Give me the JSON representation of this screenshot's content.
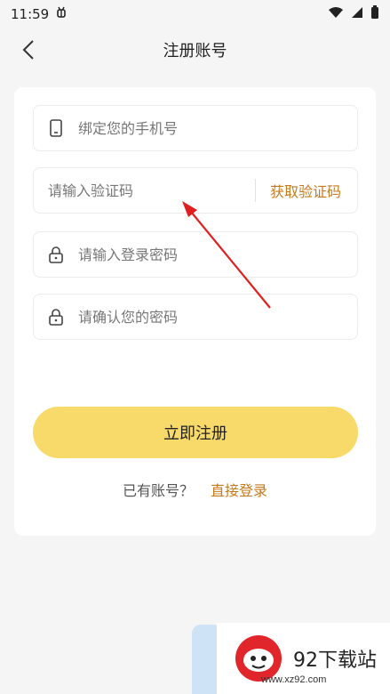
{
  "status_bar": {
    "time": "11:59",
    "notification_icon": "bug-icon",
    "icons": [
      "wifi-icon",
      "signal-icon",
      "battery-icon"
    ]
  },
  "nav": {
    "title": "注册账号",
    "back_icon": "chevron-left-icon"
  },
  "form": {
    "phone": {
      "placeholder": "绑定您的手机号",
      "icon": "phone-icon"
    },
    "code": {
      "placeholder": "请输入验证码",
      "get_code_label": "获取验证码"
    },
    "password": {
      "placeholder": "请输入登录密码",
      "icon": "lock-icon"
    },
    "confirm": {
      "placeholder": "请确认您的密码",
      "icon": "lock-icon"
    }
  },
  "submit_label": "立即注册",
  "login": {
    "question": "已有账号？",
    "link": "直接登录"
  },
  "watermark": {
    "text": "92下载站",
    "url": "www.xz92.com"
  },
  "colors": {
    "accent": "#c47a1d",
    "button": "#f8da6b",
    "arrow": "#e02020"
  }
}
